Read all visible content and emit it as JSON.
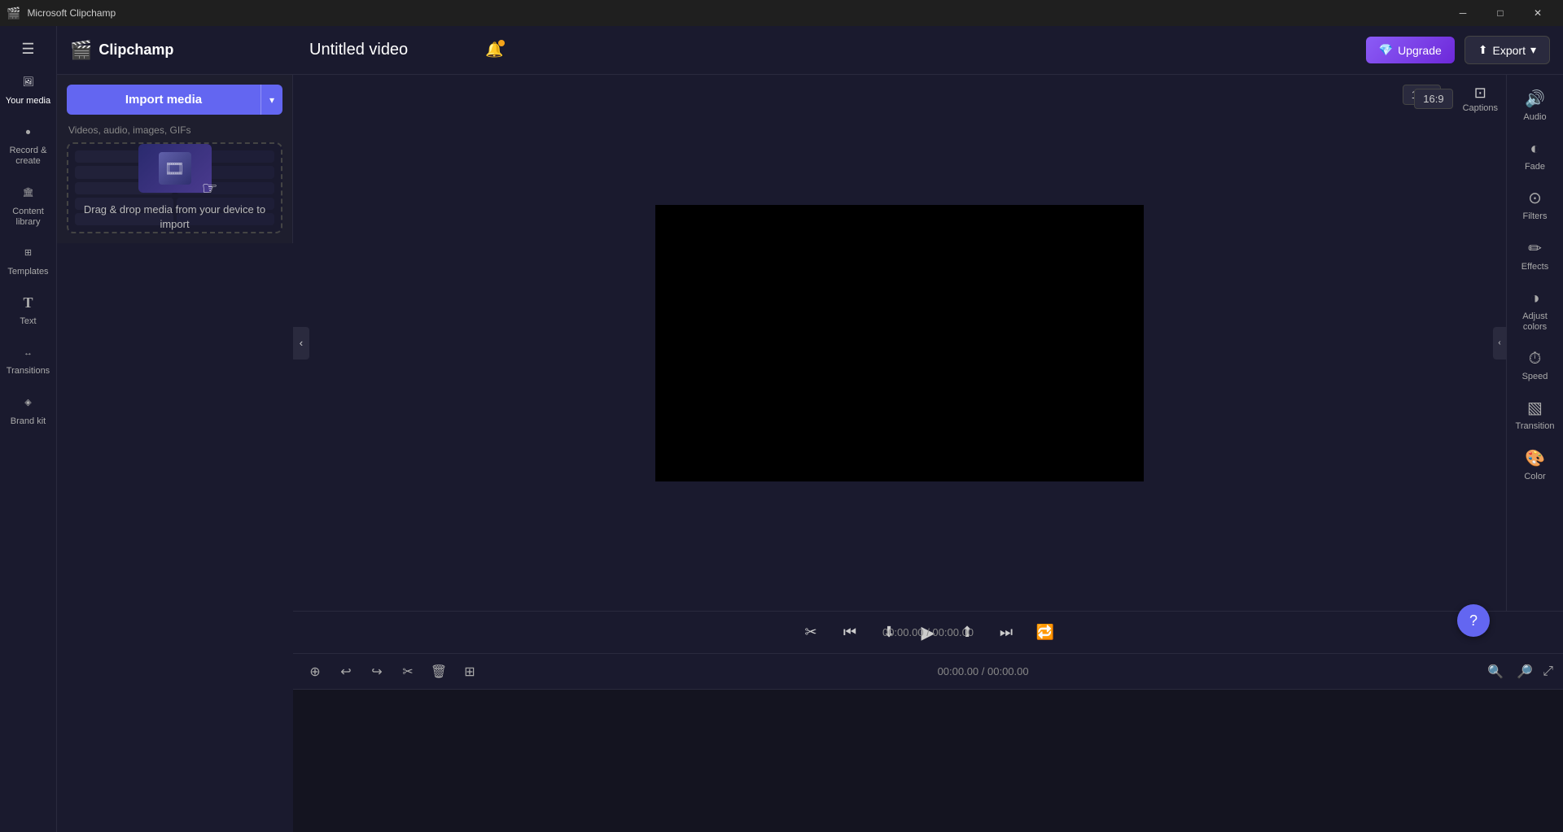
{
  "titlebar": {
    "icon": "🎬",
    "title": "Microsoft Clipchamp",
    "minimize": "─",
    "maximize": "□",
    "close": "✕"
  },
  "header": {
    "hamburger": "☰",
    "logo_text": "Clipchamp",
    "project_title": "Untitled video",
    "notification_icon": "🔔",
    "upgrade_label": "Upgrade",
    "export_label": "Export",
    "export_arrow": "▲"
  },
  "sidebar": {
    "items": [
      {
        "id": "your-media",
        "icon": "🖼",
        "label": "Your media"
      },
      {
        "id": "record-create",
        "icon": "⏺",
        "label": "Record & create"
      },
      {
        "id": "content-library",
        "icon": "🏛",
        "label": "Content library"
      },
      {
        "id": "templates",
        "icon": "⊞",
        "label": "Templates"
      },
      {
        "id": "text",
        "icon": "T",
        "label": "Text"
      },
      {
        "id": "transitions",
        "icon": "↔",
        "label": "Transitions"
      },
      {
        "id": "brand-kit",
        "icon": "◈",
        "label": "Brand kit"
      }
    ]
  },
  "media_panel": {
    "import_label": "Import media",
    "import_dropdown": "▾",
    "subtitle": "Videos, audio, images, GIFs",
    "drop_text": "Drag & drop media from your\ndevice to import"
  },
  "preview": {
    "aspect_ratio": "16:9",
    "captions_label": "Captions",
    "time_current": "00:00.00",
    "time_total": "00:00.00"
  },
  "playback": {
    "rewind": "⏮",
    "step_back": "⏪",
    "play": "▶",
    "step_forward": "⏩",
    "fast_forward": "⏭",
    "loop": "🔁"
  },
  "timeline": {
    "undo": "↩",
    "redo": "↪",
    "cut": "✂",
    "delete": "🗑",
    "add": "+",
    "time_display": "00:00.00 / 00:00.00",
    "zoom_out": "─",
    "zoom_in": "+",
    "expand": "⤢"
  },
  "right_panel": {
    "items": [
      {
        "id": "audio",
        "icon": "🔊",
        "label": "Audio"
      },
      {
        "id": "fade",
        "icon": "◐",
        "label": "Fade"
      },
      {
        "id": "filters",
        "icon": "⊙",
        "label": "Filters"
      },
      {
        "id": "effects",
        "icon": "✏",
        "label": "Effects"
      },
      {
        "id": "adjust-colors",
        "icon": "◑",
        "label": "Adjust colors"
      },
      {
        "id": "speed",
        "icon": "⏱",
        "label": "Speed"
      },
      {
        "id": "transition",
        "icon": "▧",
        "label": "Transition"
      },
      {
        "id": "color",
        "icon": "🎨",
        "label": "Color"
      }
    ]
  },
  "help": {
    "icon": "?"
  }
}
